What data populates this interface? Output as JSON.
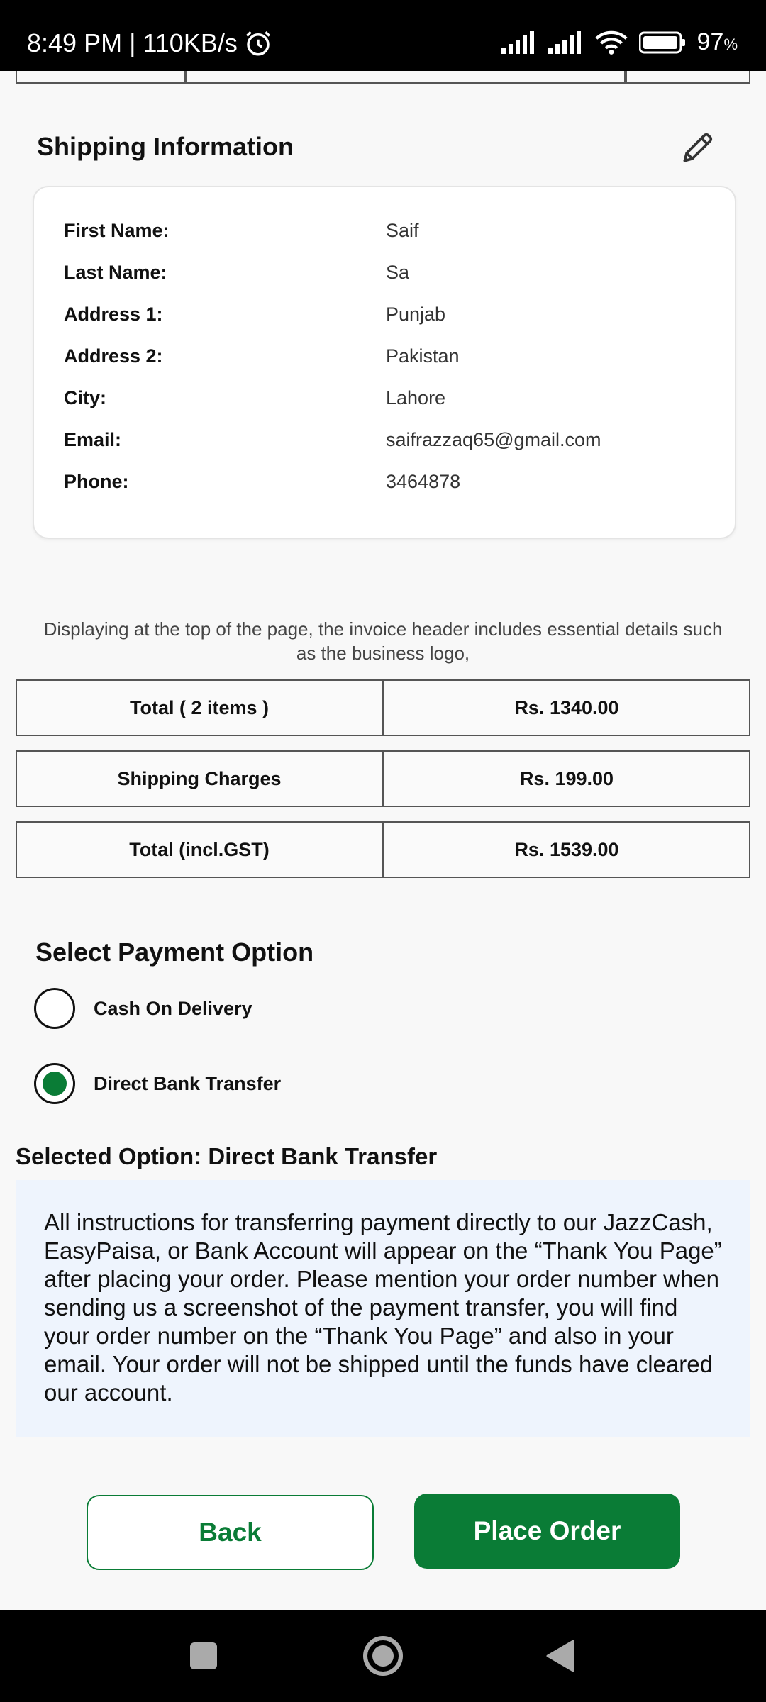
{
  "status_bar": {
    "time_speed": "8:49 PM | 110KB/s",
    "battery": "97",
    "battery_unit": "%"
  },
  "shipping": {
    "title": "Shipping Information",
    "rows": [
      {
        "label": "First Name:",
        "value": "Saif"
      },
      {
        "label": "Last Name:",
        "value": "Sa"
      },
      {
        "label": "Address 1:",
        "value": "Punjab"
      },
      {
        "label": "Address 2:",
        "value": "Pakistan"
      },
      {
        "label": "City:",
        "value": "Lahore"
      },
      {
        "label": "Email:",
        "value": "saifrazzaq65@gmail.com"
      },
      {
        "label": "Phone:",
        "value": "3464878"
      }
    ]
  },
  "invoice_note": "Displaying at the top of the page, the invoice header includes essential details such as the business logo,",
  "summary": [
    {
      "label": "Total ( 2 items )",
      "value": "Rs. 1340.00"
    },
    {
      "label": "Shipping Charges",
      "value": "Rs. 199.00"
    },
    {
      "label": "Total (incl.GST)",
      "value": "Rs. 1539.00"
    }
  ],
  "payment": {
    "title": "Select Payment Option",
    "options": [
      {
        "label": "Cash On Delivery",
        "selected": false
      },
      {
        "label": "Direct Bank Transfer",
        "selected": true
      }
    ],
    "selected_label": "Selected Option: Direct Bank Transfer",
    "instructions": "All instructions for transferring payment directly to our JazzCash, EasyPaisa, or Bank Account will appear on the “Thank You Page” after placing your order. Please mention your order number when sending us a screenshot of the payment transfer, you will find your order number on the “Thank You Page” and also in your email. Your order will not be shipped until the funds have cleared our account."
  },
  "buttons": {
    "back": "Back",
    "place_order": "Place Order"
  },
  "colors": {
    "accent": "#0a7c36",
    "info_bg": "#eef4fd"
  }
}
